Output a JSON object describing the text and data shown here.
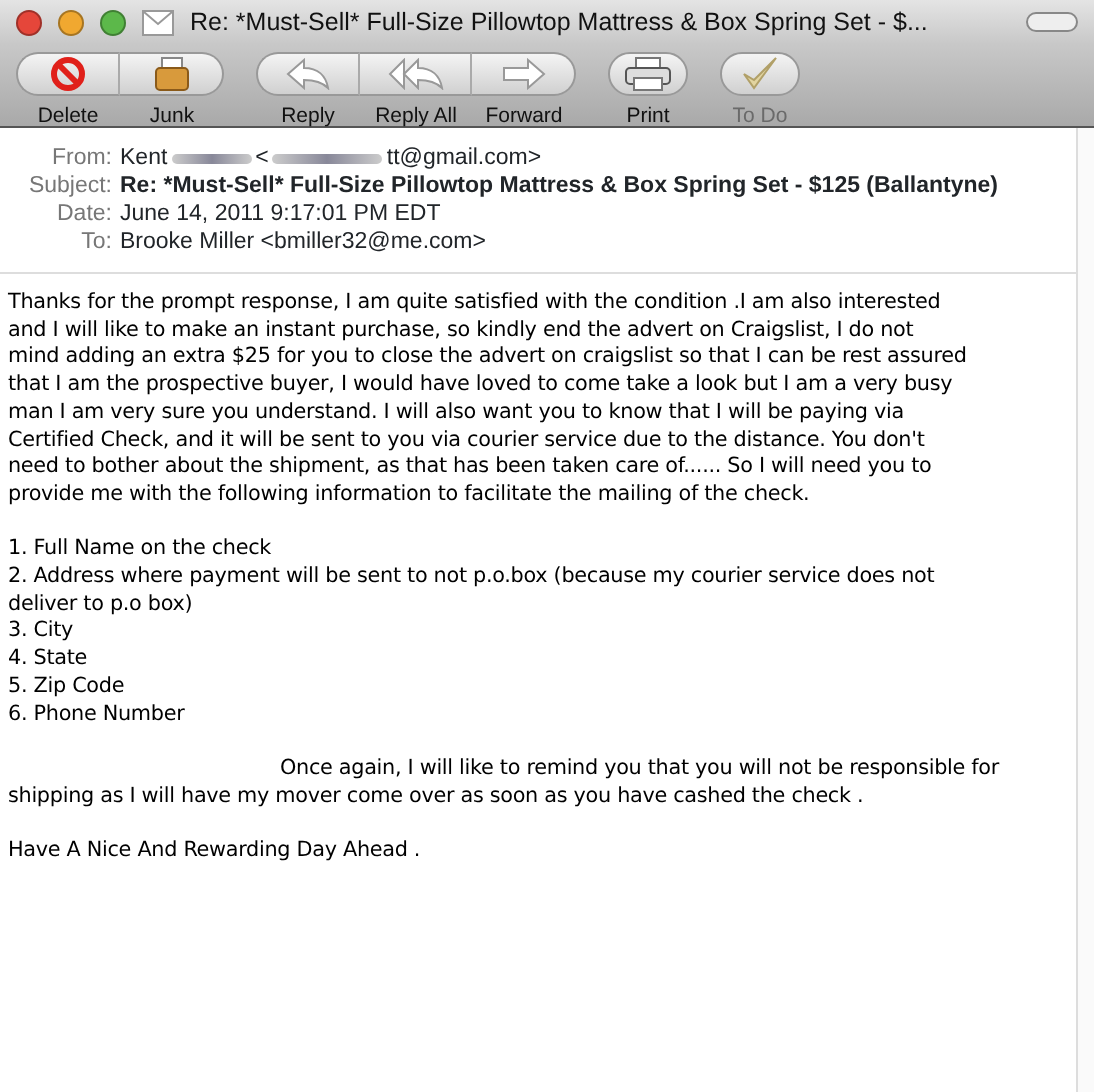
{
  "window": {
    "title": "Re: *Must-Sell* Full-Size Pillowtop Mattress & Box Spring Set - $..."
  },
  "toolbar": [
    {
      "group": [
        {
          "label": "Delete",
          "kind": "delete",
          "disabled": false
        },
        {
          "label": "Junk",
          "kind": "junk",
          "disabled": false
        }
      ]
    },
    {
      "group": [
        {
          "label": "Reply",
          "kind": "reply",
          "disabled": false
        },
        {
          "label": "Reply All",
          "kind": "replyall",
          "disabled": false
        },
        {
          "label": "Forward",
          "kind": "forward",
          "disabled": false
        }
      ]
    },
    {
      "group": [
        {
          "label": "Print",
          "kind": "print",
          "disabled": false
        }
      ]
    },
    {
      "group": [
        {
          "label": "To Do",
          "kind": "todo",
          "disabled": true
        }
      ]
    }
  ],
  "headers": {
    "from_label": "From:",
    "from_name": "Kent",
    "from_lt": "<",
    "from_address_end": "tt@gmail.com>",
    "subject_label": "Subject:",
    "subject": "Re: *Must-Sell* Full-Size Pillowtop Mattress & Box Spring Set - $125 (Ballantyne)",
    "date_label": "Date:",
    "date": "June 14, 2011 9:17:01 PM EDT",
    "to_label": "To:",
    "to": "Brooke Miller <bmiller32@me.com>"
  },
  "body": [
    {
      "kind": "paragraph",
      "text": "Thanks for the prompt response, I am quite satisfied with the condition .I am also interested\nand I will like to make an instant purchase, so kindly end the advert on Craigslist, I do not\nmind adding an extra $25 for you to close the advert on craigslist so that I can be rest assured\nthat I am the prospective buyer, I would have loved to come take a look but I am a very busy\nman I am very sure you understand. I will also want you to know that I will be paying via\nCertified Check, and it will be sent to you via courier service due to the distance. You don't\nneed to bother about the shipment, as that has been taken care of...... So I will need you to\nprovide me with the following information to facilitate the mailing of the check."
    },
    {
      "kind": "list",
      "items": [
        "1. Full Name on the check",
        "2. Address where payment will be sent to not p.o.box (because my courier service does not\ndeliver to p.o box)",
        "3. City",
        "4. State",
        "5. Zip Code",
        "6. Phone Number"
      ]
    },
    {
      "kind": "indented",
      "text": "Once again, I will like to remind you that you will not be responsible for\nshipping as I will have my mover come over as soon as you have cashed the check ."
    },
    {
      "kind": "paragraph",
      "text": "Have A Nice And Rewarding Day Ahead ."
    }
  ]
}
